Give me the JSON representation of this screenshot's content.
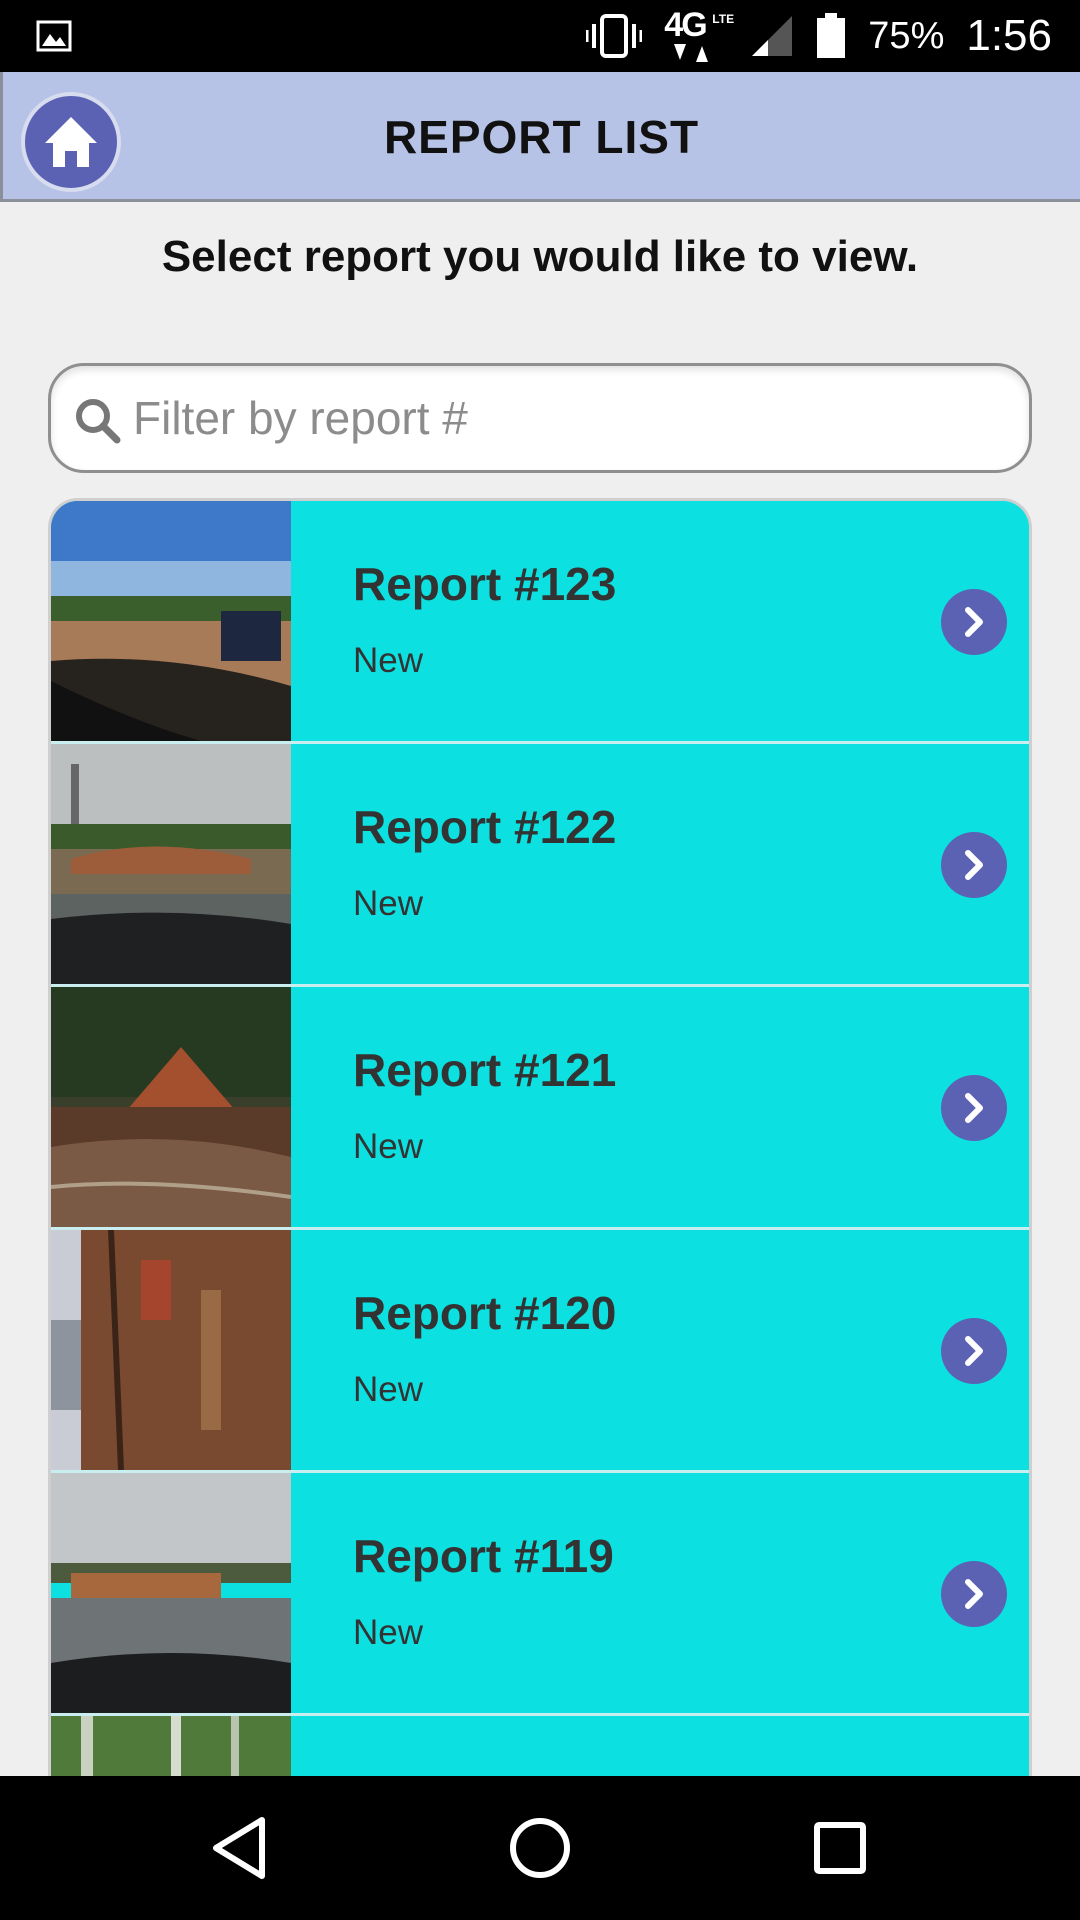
{
  "status_bar": {
    "network": "4G",
    "network_sub": "LTE",
    "battery": "75%",
    "time": "1:56",
    "icons": [
      "gallery-icon",
      "vibrate-icon",
      "network-4g-icon",
      "signal-icon",
      "battery-icon"
    ]
  },
  "header": {
    "title": "REPORT LIST",
    "home_icon": "home-icon"
  },
  "instruction": "Select report you would like to view.",
  "search": {
    "placeholder": "Filter by report #",
    "value": "",
    "icon": "search-icon"
  },
  "reports": [
    {
      "title": "Report #123",
      "status": "New"
    },
    {
      "title": "Report #122",
      "status": "New"
    },
    {
      "title": "Report #121",
      "status": "New"
    },
    {
      "title": "Report #120",
      "status": "New"
    },
    {
      "title": "Report #119",
      "status": "New"
    },
    {
      "title": "",
      "status": ""
    }
  ],
  "colors": {
    "header_bg": "#b6c3e6",
    "row_bg": "#0de0e0",
    "accent": "#5b62b4"
  },
  "nav_bar": {
    "icons": [
      "back-icon",
      "home-circle-icon",
      "recents-icon"
    ]
  }
}
